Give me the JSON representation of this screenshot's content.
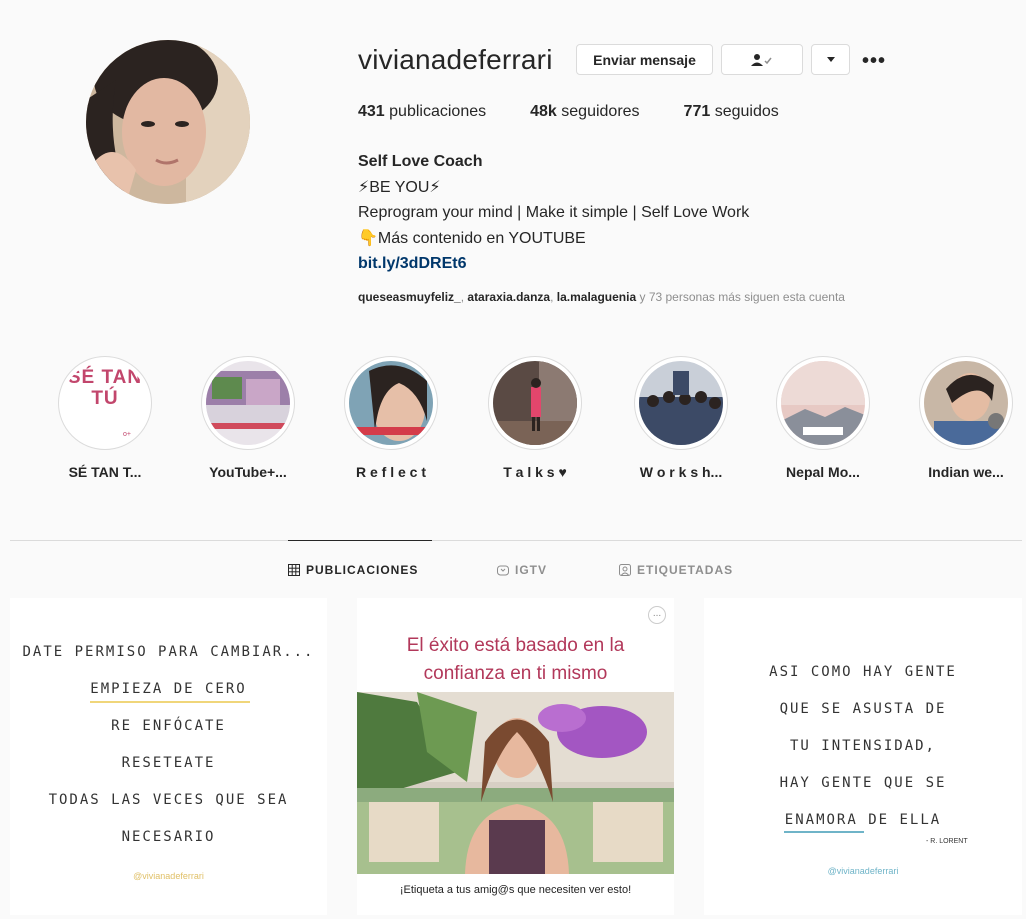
{
  "profile": {
    "username": "vivianadeferrari",
    "message_button": "Enviar mensaje",
    "follow_icon": "person-check-icon",
    "dropdown_icon": "chevron-down-icon",
    "more_icon": "more-icon",
    "stats": {
      "posts_count": "431",
      "posts_label": "publicaciones",
      "followers_count": "48k",
      "followers_label": "seguidores",
      "following_count": "771",
      "following_label": "seguidos"
    },
    "bio": {
      "name": "Self Love Coach",
      "line1": "⚡BE YOU⚡",
      "line2": "Reprogram your mind | Make it simple | Self Love Work",
      "line3": "👇Más contenido en YOUTUBE",
      "link": "bit.ly/3dDREt6"
    },
    "followed_by": {
      "user1": "queseasmuyfeliz_",
      "sep1": ", ",
      "user2": "ataraxia.danza",
      "sep2": ", ",
      "user3": "la.malaguenia",
      "rest": " y 73 personas más siguen esta cuenta"
    }
  },
  "highlights": [
    {
      "label": "SÉ TAN T...",
      "cover_text": "SÉ TAN TÚ",
      "cover_small": "o+"
    },
    {
      "label": "YouTube+..."
    },
    {
      "label": "R e f l e c t"
    },
    {
      "label": "T a l k s ♥"
    },
    {
      "label": "W o r k s h..."
    },
    {
      "label": "Nepal Mo..."
    },
    {
      "label": "Indian we..."
    }
  ],
  "tabs": [
    {
      "label": "PUBLICACIONES",
      "icon": "grid-icon"
    },
    {
      "label": "IGTV",
      "icon": "igtv-icon"
    },
    {
      "label": "ETIQUETADAS",
      "icon": "tagged-icon"
    }
  ],
  "posts": [
    {
      "lines": [
        "DATE PERMISO PARA CAMBIAR...",
        "EMPIEZA DE CERO",
        "RE ENFÓCATE",
        "RESETEATE",
        "TODAS LAS VECES QUE SEA",
        "NECESARIO"
      ],
      "handle": "@vivianadeferrari"
    },
    {
      "title": "El éxito está basado en la confianza en ti mismo",
      "caption": "¡Etiqueta a tus amig@s que necesiten ver esto!",
      "badge": "..."
    },
    {
      "lines": [
        "ASI COMO HAY GENTE",
        "QUE SE ASUSTA DE",
        "TU INTENSIDAD,",
        "HAY GENTE QUE SE",
        "ENAMORA DE ELLA"
      ],
      "author": "- R. LORENT",
      "handle": "@vivianadeferrari"
    }
  ],
  "colors": {
    "link": "#00376b",
    "muted": "#8e8e8e",
    "border": "#dbdbdb",
    "accent_pink": "#b2385a"
  }
}
